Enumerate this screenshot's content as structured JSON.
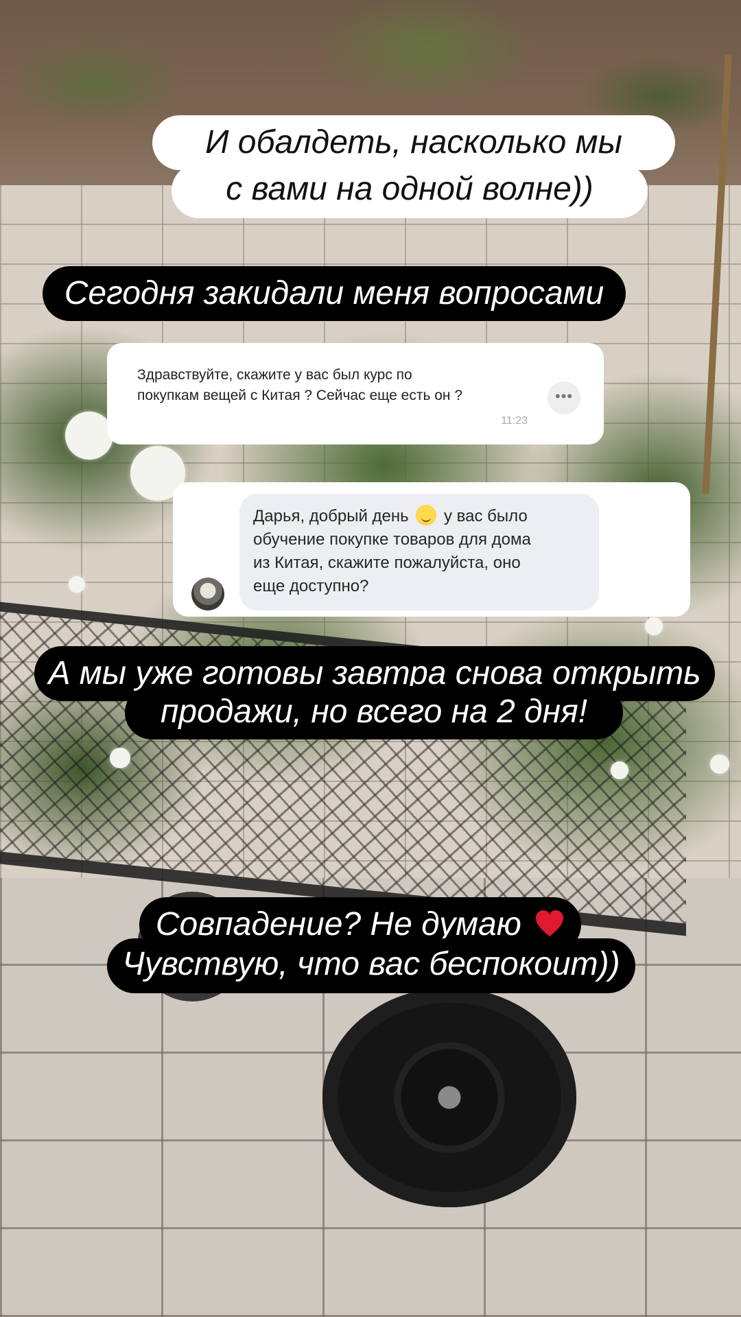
{
  "captions": {
    "top_line1": "И обалдеть, насколько мы",
    "top_line2": "с вами на одной волне))",
    "questions": "Сегодня закидали меня вопросами",
    "sales_line1": "А мы уже готовы завтра снова открыть",
    "sales_line2": "продажи, но всего на 2 дня!",
    "coincidence_line1": "Совпадение? Не думаю",
    "coincidence_line2": "Чувствую, что вас беспокоит))"
  },
  "message1": {
    "line1": "Здравствуйте, скажите у вас был курс по",
    "line2": "покупкам вещей  с Китая ? Сейчас еще есть он ?",
    "time": "11:23",
    "more_icon": "more-dots-icon"
  },
  "message2": {
    "line1_before_emoji": "Дарья, добрый день",
    "line1_after_emoji": "у вас было",
    "line2": "обучение покупке товаров для дома",
    "line3": "из Китая, скажите пожалуйста, оно",
    "line4": "еще доступно?",
    "emoji_icon": "relieved-face-emoji-icon",
    "avatar_icon": "sender-avatar"
  },
  "colors": {
    "caption_light_bg": "#ffffff",
    "caption_dark_bg": "#000000",
    "bubble_bg": "#eceef1",
    "heart": "#e0192e"
  }
}
